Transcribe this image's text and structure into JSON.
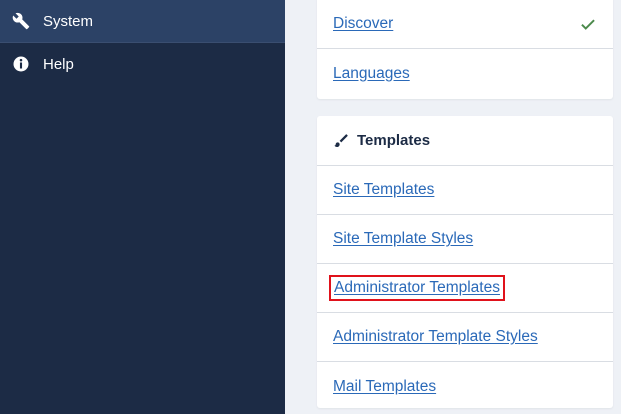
{
  "sidebar": {
    "items": [
      {
        "label": "System",
        "icon": "wrench-icon",
        "active": true
      },
      {
        "label": "Help",
        "icon": "info-icon",
        "active": false
      }
    ]
  },
  "main": {
    "top_card": {
      "links": [
        {
          "label": "Discover",
          "status_icon": "check-icon"
        },
        {
          "label": "Languages"
        }
      ]
    },
    "templates_card": {
      "title": "Templates",
      "icon": "brush-icon",
      "links": [
        {
          "label": "Site Templates"
        },
        {
          "label": "Site Template Styles"
        },
        {
          "label": "Administrator Templates",
          "highlighted": true
        },
        {
          "label": "Administrator Template Styles"
        },
        {
          "label": "Mail Templates"
        }
      ]
    }
  },
  "colors": {
    "sidebar_bg": "#1c2b45",
    "sidebar_active": "#2c4266",
    "link": "#2a69b8",
    "check": "#4b8a4b",
    "highlight": "#e0121b"
  }
}
